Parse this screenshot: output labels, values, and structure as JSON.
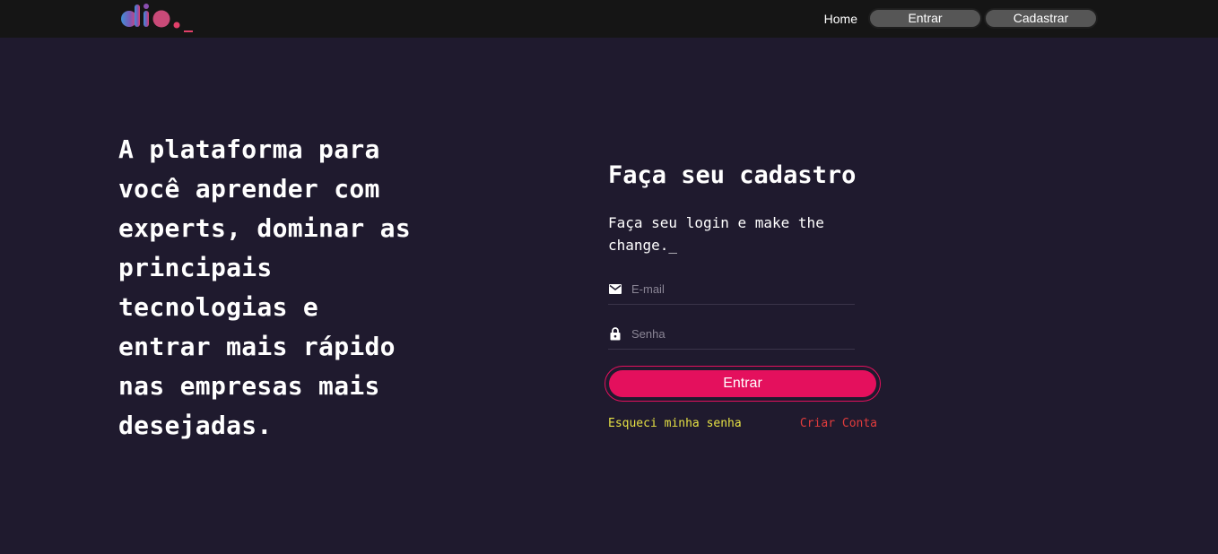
{
  "header": {
    "logo_text": "dio._",
    "nav": {
      "home_label": "Home",
      "enter_label": "Entrar",
      "signup_label": "Cadastrar"
    }
  },
  "hero": {
    "title": "A plataforma para você aprender com experts, dominar as principais tecnologias e entrar mais rápido nas empresas mais desejadas."
  },
  "form": {
    "title": "Faça seu cadastro",
    "subtitle": "Faça seu login e make the change._",
    "email_placeholder": "E-mail",
    "password_placeholder": "Senha",
    "submit_label": "Entrar",
    "forgot_label": "Esqueci minha senha",
    "create_label": "Criar Conta"
  },
  "colors": {
    "background": "#1f1a2e",
    "header": "#151515",
    "accent": "#e4105d",
    "forgot_link": "#e5e044",
    "create_link": "#e23c3c"
  },
  "icons": {
    "email": "mail-icon",
    "password": "lock-icon"
  }
}
